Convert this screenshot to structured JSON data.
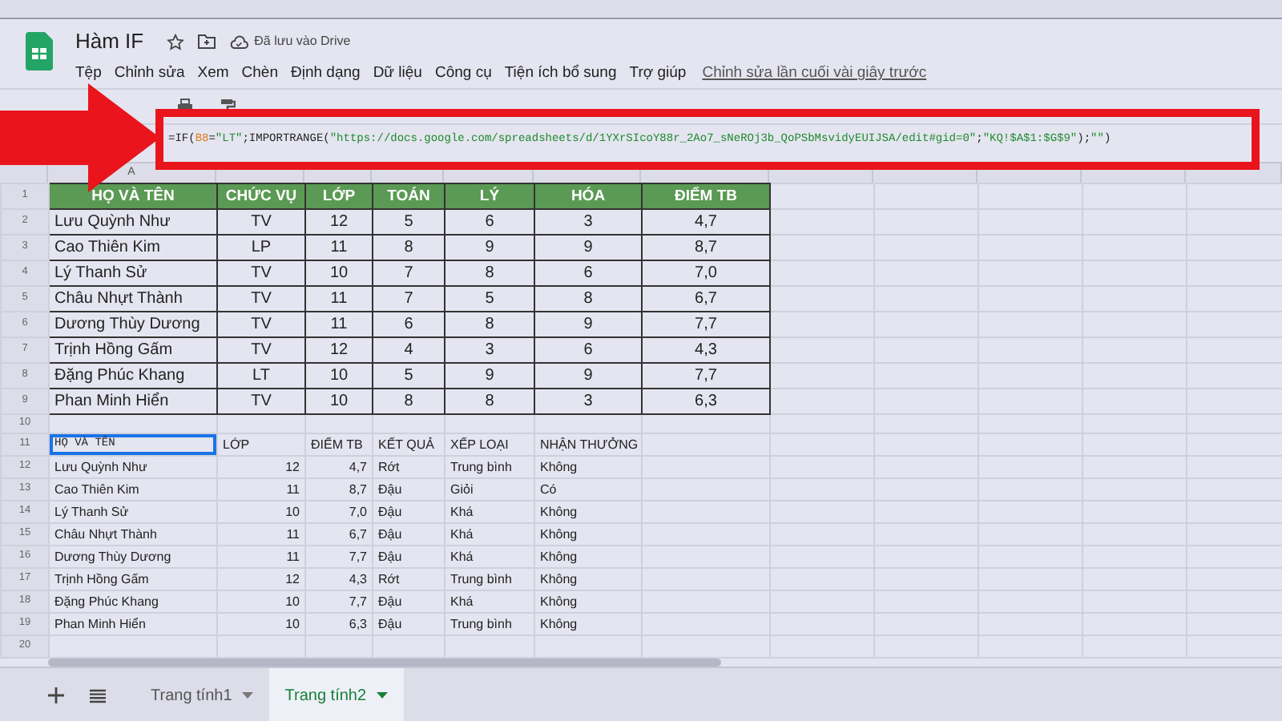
{
  "doc": {
    "title": "Hàm IF",
    "save_status": "Đã lưu vào Drive"
  },
  "menu": [
    "Tệp",
    "Chỉnh sửa",
    "Xem",
    "Chèn",
    "Định dạng",
    "Dữ liệu",
    "Công cụ",
    "Tiện ích bổ sung",
    "Trợ giúp"
  ],
  "last_edit": "Chỉnh sửa lần cuối vài giây trước",
  "formula": [
    {
      "text": "=IF(",
      "kind": "plain"
    },
    {
      "text": "B8",
      "kind": "ref"
    },
    {
      "text": "=",
      "kind": "plain"
    },
    {
      "text": "\"LT\"",
      "kind": "string"
    },
    {
      "text": ";IMPORTRANGE(",
      "kind": "plain"
    },
    {
      "text": "\"https://docs.google.com/spreadsheets/d/1YXrSIcoY88r_2Ao7_sNeROj3b_QoPSbMsvidyEUIJSA/edit#gid=0\"",
      "kind": "string"
    },
    {
      "text": ";",
      "kind": "plain"
    },
    {
      "text": "\"KQ!$A$1:$G$9\"",
      "kind": "string"
    },
    {
      "text": ");",
      "kind": "plain"
    },
    {
      "text": "\"\"",
      "kind": "string"
    },
    {
      "text": ")",
      "kind": "plain"
    }
  ],
  "column_letters": [
    "A"
  ],
  "row_numbers": [
    "1",
    "2",
    "3",
    "4",
    "5",
    "6",
    "7",
    "8",
    "9",
    "10",
    "11",
    "12",
    "13",
    "14",
    "15",
    "16",
    "17",
    "18",
    "19",
    "20"
  ],
  "score_table": {
    "header": [
      "HỌ VÀ TÊN",
      "CHỨC VỤ",
      "LỚP",
      "TOÁN",
      "LÝ",
      "HÓA",
      "ĐIỂM TB"
    ],
    "rows": [
      [
        "Lưu Quỳnh Như",
        "TV",
        "12",
        "5",
        "6",
        "3",
        "4,7"
      ],
      [
        "Cao Thiên Kim",
        "LP",
        "11",
        "8",
        "9",
        "9",
        "8,7"
      ],
      [
        "Lý Thanh Sử",
        "TV",
        "10",
        "7",
        "8",
        "6",
        "7,0"
      ],
      [
        "Châu Nhựt Thành",
        "TV",
        "11",
        "7",
        "5",
        "8",
        "6,7"
      ],
      [
        "Dương Thùy Dương",
        "TV",
        "11",
        "6",
        "8",
        "9",
        "7,7"
      ],
      [
        "Trịnh Hồng Gấm",
        "TV",
        "12",
        "4",
        "3",
        "6",
        "4,3"
      ],
      [
        "Đặng Phúc Khang",
        "LT",
        "10",
        "5",
        "9",
        "9",
        "7,7"
      ],
      [
        "Phan Minh Hiển",
        "TV",
        "10",
        "8",
        "8",
        "3",
        "6,3"
      ]
    ]
  },
  "result_table": {
    "header": [
      {
        "text": "HỌ VÀ TÊN",
        "selected": true
      },
      {
        "text": "LỚP",
        "selected": false
      },
      {
        "text": "ĐIỂM TB",
        "selected": false
      },
      {
        "text": "KẾT QUẢ",
        "selected": false
      },
      {
        "text": "XẾP LOẠI",
        "selected": false
      },
      {
        "text": "NHẬN THƯỞNG",
        "selected": false
      }
    ],
    "rows": [
      [
        "Lưu Quỳnh Như",
        "12",
        "4,7",
        "Rớt",
        "Trung bình",
        "Không"
      ],
      [
        "Cao Thiên Kim",
        "11",
        "8,7",
        "Đậu",
        "Giỏi",
        "Có"
      ],
      [
        "Lý Thanh Sử",
        "10",
        "7,0",
        "Đậu",
        "Khá",
        "Không"
      ],
      [
        "Châu Nhựt Thành",
        "11",
        "6,7",
        "Đậu",
        "Khá",
        "Không"
      ],
      [
        "Dương Thùy Dương",
        "11",
        "7,7",
        "Đậu",
        "Khá",
        "Không"
      ],
      [
        "Trịnh Hồng Gấm",
        "12",
        "4,3",
        "Rớt",
        "Trung bình",
        "Không"
      ],
      [
        "Đặng Phúc Khang",
        "10",
        "7,7",
        "Đậu",
        "Khá",
        "Không"
      ],
      [
        "Phan Minh Hiển",
        "10",
        "6,3",
        "Đậu",
        "Trung bình",
        "Không"
      ]
    ]
  },
  "tabs": [
    {
      "label": "Trang tính1",
      "selected": false
    },
    {
      "label": "Trang tính2",
      "selected": true
    }
  ]
}
